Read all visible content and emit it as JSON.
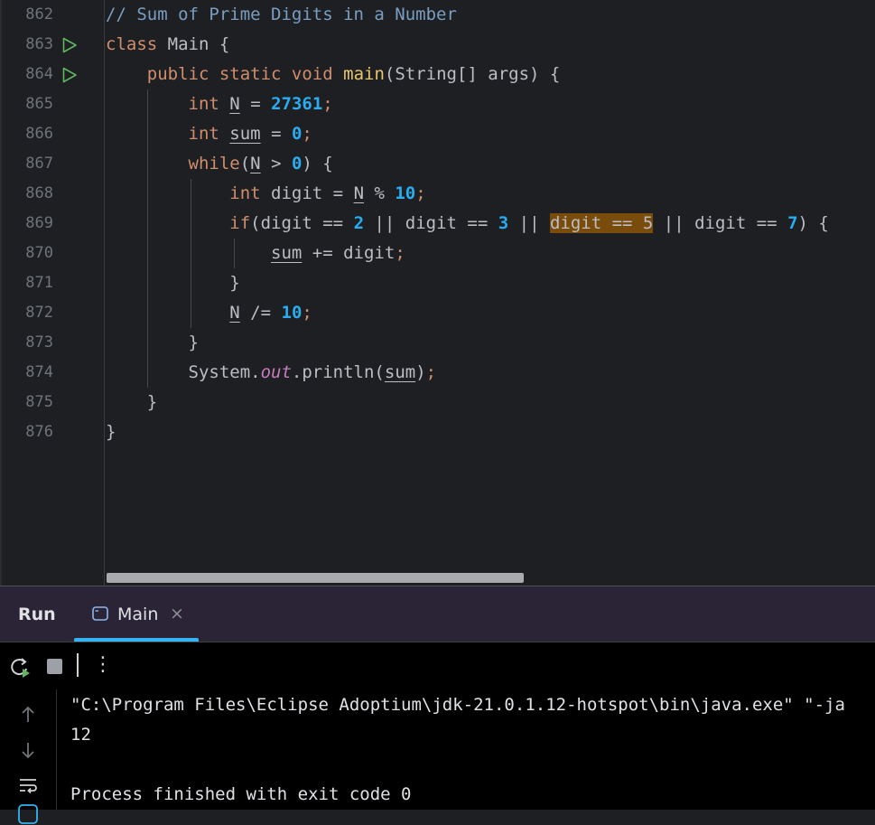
{
  "editor": {
    "lines": [
      {
        "num": "862",
        "run": false,
        "tokens": [
          [
            "cmt",
            "// Sum of Prime Digits in a Number"
          ]
        ]
      },
      {
        "num": "863",
        "run": true,
        "tokens": [
          [
            "kw",
            "class"
          ],
          [
            "",
            " Main {"
          ]
        ]
      },
      {
        "num": "864",
        "run": true,
        "tokens": [
          [
            "",
            "    "
          ],
          [
            "kw",
            "public static void"
          ],
          [
            "",
            " "
          ],
          [
            "fn",
            "main"
          ],
          [
            "",
            "(String[] args) {"
          ]
        ]
      },
      {
        "num": "865",
        "run": false,
        "tokens": [
          [
            "",
            "        "
          ],
          [
            "kw",
            "int"
          ],
          [
            "",
            " "
          ],
          [
            "ul",
            "N"
          ],
          [
            "",
            " = "
          ],
          [
            "num",
            "27361"
          ],
          [
            "semi",
            ";"
          ]
        ]
      },
      {
        "num": "866",
        "run": false,
        "tokens": [
          [
            "",
            "        "
          ],
          [
            "kw",
            "int"
          ],
          [
            "",
            " "
          ],
          [
            "ul",
            "sum"
          ],
          [
            "",
            " = "
          ],
          [
            "num",
            "0"
          ],
          [
            "semi",
            ";"
          ]
        ]
      },
      {
        "num": "867",
        "run": false,
        "tokens": [
          [
            "",
            "        "
          ],
          [
            "kw",
            "while"
          ],
          [
            "",
            "("
          ],
          [
            "ul",
            "N"
          ],
          [
            "",
            " > "
          ],
          [
            "num",
            "0"
          ],
          [
            "",
            ") {"
          ]
        ]
      },
      {
        "num": "868",
        "run": false,
        "tokens": [
          [
            "",
            "            "
          ],
          [
            "kw",
            "int"
          ],
          [
            "",
            " digit = "
          ],
          [
            "ul",
            "N"
          ],
          [
            "",
            " % "
          ],
          [
            "num",
            "10"
          ],
          [
            "semi",
            ";"
          ]
        ]
      },
      {
        "num": "869",
        "run": false,
        "tokens": [
          [
            "",
            "            "
          ],
          [
            "kw",
            "if"
          ],
          [
            "",
            "(digit == "
          ],
          [
            "num",
            "2"
          ],
          [
            "",
            " || digit == "
          ],
          [
            "num",
            "3"
          ],
          [
            "",
            " || "
          ],
          [
            "hl",
            "digit == 5"
          ],
          [
            "",
            " || digit == "
          ],
          [
            "num",
            "7"
          ],
          [
            "",
            ") {"
          ]
        ]
      },
      {
        "num": "870",
        "run": false,
        "tokens": [
          [
            "",
            "                "
          ],
          [
            "ul",
            "sum"
          ],
          [
            "",
            " += digit"
          ],
          [
            "semi",
            ";"
          ]
        ]
      },
      {
        "num": "871",
        "run": false,
        "tokens": [
          [
            "",
            "            }"
          ]
        ]
      },
      {
        "num": "872",
        "run": false,
        "tokens": [
          [
            "",
            "            "
          ],
          [
            "ul",
            "N"
          ],
          [
            "",
            " /= "
          ],
          [
            "num",
            "10"
          ],
          [
            "semi",
            ";"
          ]
        ]
      },
      {
        "num": "873",
        "run": false,
        "tokens": [
          [
            "",
            "        }"
          ]
        ]
      },
      {
        "num": "874",
        "run": false,
        "tokens": [
          [
            "",
            "        System."
          ],
          [
            "fld",
            "out"
          ],
          [
            "",
            ".println("
          ],
          [
            "ul",
            "sum"
          ],
          [
            "",
            ")"
          ],
          [
            "semi",
            ";"
          ]
        ]
      },
      {
        "num": "875",
        "run": false,
        "tokens": [
          [
            "",
            "    }"
          ]
        ]
      },
      {
        "num": "876",
        "run": false,
        "tokens": [
          [
            "",
            "}"
          ]
        ]
      }
    ]
  },
  "run_panel": {
    "title": "Run",
    "tab_label": "Main",
    "tab_close": "×",
    "more": "⋮"
  },
  "console": {
    "lines": [
      "\"C:\\Program Files\\Eclipse Adoptium\\jdk-21.0.1.12-hotspot\\bin\\java.exe\" \"-ja",
      "12",
      "",
      "Process finished with exit code 0"
    ]
  },
  "colors": {
    "accent": "#35b3f2",
    "keyword": "#cf8e6d",
    "number": "#2aacf0",
    "comment": "#7a9ec2",
    "highlight": "#7a4c0b"
  }
}
